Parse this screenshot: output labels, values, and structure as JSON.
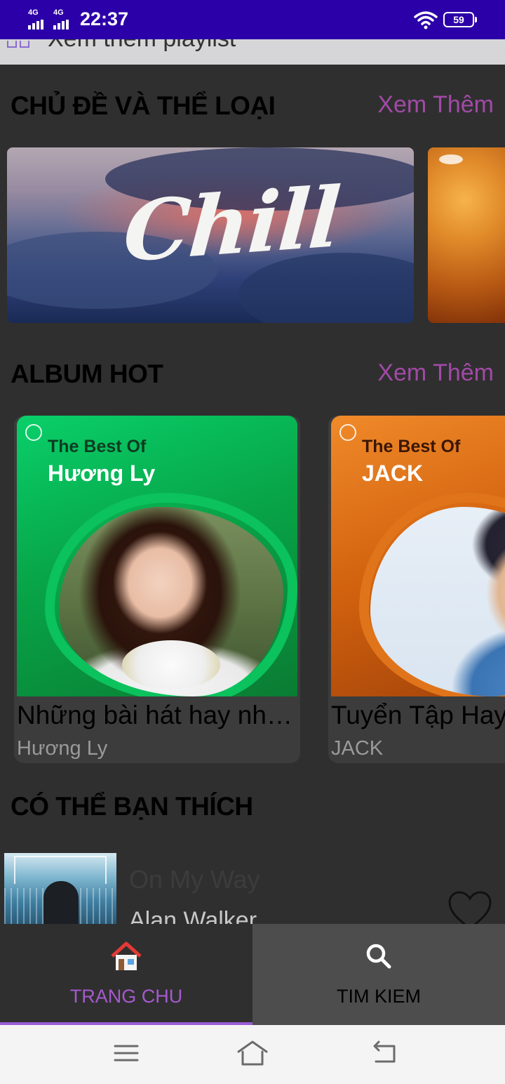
{
  "status_bar": {
    "network_1": "4G",
    "network_2": "4G",
    "time": "22:37",
    "battery": "59",
    "icons": [
      "signal-icon",
      "signal-icon",
      "wifi-icon",
      "battery-icon"
    ]
  },
  "partial_header": {
    "text": "Xem thêm playlist"
  },
  "genres": {
    "title": "CHỦ ĐỀ VÀ THỂ LOẠI",
    "more_label": "Xem Thêm",
    "items": [
      {
        "label": "Chill"
      }
    ]
  },
  "albums": {
    "title": "ALBUM HOT",
    "more_label": "Xem Thêm",
    "items": [
      {
        "cover_top": "The Best Of",
        "cover_name": "Hương Ly",
        "title": "Những bài hát hay nhất của Hương Ly",
        "artist": "Hương Ly"
      },
      {
        "cover_top": "The Best Of",
        "cover_name": "JACK",
        "title": "Tuyển Tập Hay Nhất",
        "artist": "JACK"
      }
    ]
  },
  "suggestions": {
    "title": "CÓ THỂ BẠN THÍCH",
    "items": [
      {
        "title": "On My Way",
        "artist": "Alan Walker",
        "icon": "heart-icon"
      }
    ]
  },
  "bottom_nav": {
    "tabs": [
      {
        "label": "TRANG CHU",
        "icon": "home-icon",
        "active": true
      },
      {
        "label": "TIM KIEM",
        "icon": "search-icon",
        "active": false
      }
    ],
    "active_color": "#a659cf"
  },
  "system_nav": {
    "icons": [
      "menu-icon",
      "home-icon",
      "back-icon"
    ]
  }
}
